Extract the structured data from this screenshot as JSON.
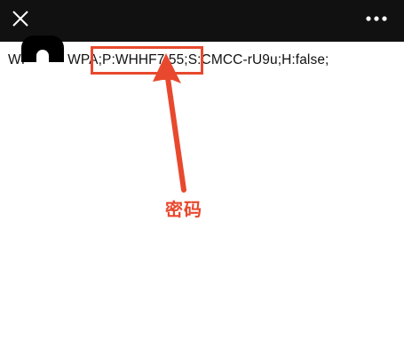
{
  "header": {
    "close_icon": "close-icon",
    "more_icon": "more-horizontal-icon",
    "background_color": "#111111"
  },
  "content": {
    "wifi_string_prefix": "WI",
    "wifi_string_rest": "WPA;P:WHHF7 55;S:CMCC-rU9u;H:false;"
  },
  "annotation": {
    "label": "密码",
    "color": "#e8492e",
    "arrow_icon": "arrow-up-icon"
  }
}
